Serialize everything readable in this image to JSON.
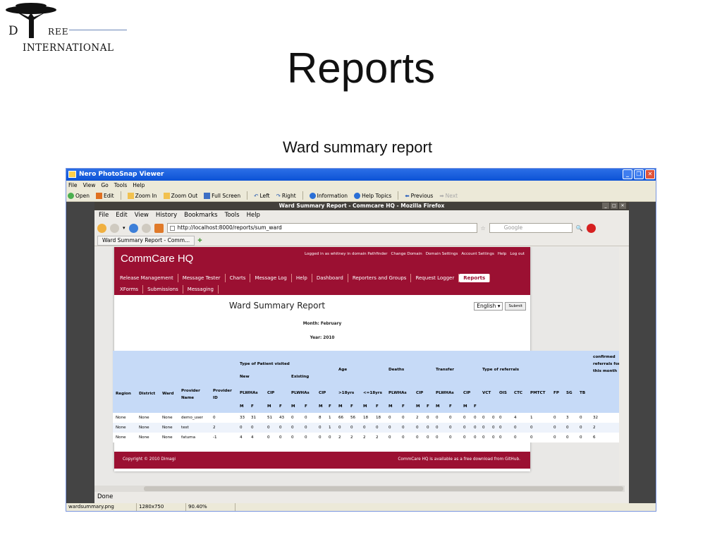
{
  "logo": {
    "d": "D",
    "ree": "REE",
    "intl": "INTERNATIONAL"
  },
  "slide": {
    "title": "Reports",
    "subtitle": "Ward summary  report"
  },
  "viewer": {
    "title": "Nero PhotoSnap Viewer",
    "menu": [
      "File",
      "View",
      "Go",
      "Tools",
      "Help"
    ],
    "toolbar": [
      "Open",
      "Edit",
      "Zoom In",
      "Zoom Out",
      "Full Screen",
      "Left",
      "Right",
      "Information",
      "Help Topics",
      "Previous",
      "Next"
    ],
    "status": {
      "file": "wardsummary.png",
      "dims": "1280x750",
      "zoom": "90.40%"
    }
  },
  "firefox": {
    "title": "Ward Summary Report - Commcare HQ - Mozilla Firefox",
    "menu": [
      "File",
      "Edit",
      "View",
      "History",
      "Bookmarks",
      "Tools",
      "Help"
    ],
    "url": "http://localhost:8000/reports/sum_ward",
    "search_placeholder": "Google",
    "tab": "Ward Summary Report - Comm...",
    "status": "Done"
  },
  "commcare": {
    "brand": "CommCare HQ",
    "user_bar": [
      "Logged in as whitney in domain Pathfinder",
      "Change Domain",
      "Domain Settings",
      "Account Settings",
      "Help",
      "Log out"
    ],
    "tabs_row1": [
      "Release Management",
      "Message Tester",
      "Charts",
      "Message Log",
      "Help",
      "Dashboard",
      "Reporters and Groups",
      "Request Logger",
      "Reports"
    ],
    "tabs_row2": [
      "XForms",
      "Submissions",
      "Messaging"
    ],
    "active_tab": "Reports",
    "report_title": "Ward Summary Report",
    "language": "English",
    "submit": "Submit",
    "month": "Month: February",
    "year": "Year: 2010",
    "footer_left": "Copyright © 2010 Dimagi",
    "footer_right": "CommCare HQ is available as a free download from GitHub."
  },
  "report": {
    "group_headers": [
      "Type of Patient visited",
      "Age",
      "Deaths",
      "Transfer",
      "Type of referrals",
      "confirmed referrals for this month"
    ],
    "sub_headers": [
      "New",
      "Existing"
    ],
    "columns": [
      "Region",
      "District",
      "Ward",
      "Provider Name",
      "Provider ID",
      "PLWHAs",
      "CIP",
      "PLWHAs",
      "CIP",
      ">18yrs",
      "<=18yrs",
      "PLWHAs",
      "CIP",
      "PLWHAs",
      "CIP",
      "VCT",
      "OIS",
      "CTC",
      "PMTCT",
      "FP",
      "SG",
      "TB"
    ],
    "mf": [
      "M",
      "F",
      "M",
      "F",
      "M",
      "F",
      "M",
      "F",
      "M",
      "F",
      "M",
      "F",
      "M",
      "F",
      "M",
      "F",
      "M",
      "F",
      "M",
      "F"
    ],
    "rows": [
      [
        "None",
        "None",
        "None",
        "demo_user",
        "0",
        "33",
        "31",
        "51",
        "43",
        "0",
        "0",
        "8",
        "1",
        "66",
        "56",
        "18",
        "18",
        "0",
        "0",
        "2",
        "0",
        "0",
        "0",
        "0",
        "0",
        "0",
        "0",
        "0",
        "4",
        "1",
        "0",
        "3",
        "0",
        "32"
      ],
      [
        "None",
        "None",
        "None",
        "test",
        "2",
        "0",
        "0",
        "0",
        "0",
        "0",
        "0",
        "0",
        "1",
        "0",
        "0",
        "0",
        "0",
        "0",
        "0",
        "0",
        "0",
        "0",
        "0",
        "0",
        "0",
        "0",
        "0",
        "0",
        "0",
        "0",
        "0",
        "0",
        "0",
        "2"
      ],
      [
        "None",
        "None",
        "None",
        "fatuma",
        "-1",
        "4",
        "4",
        "0",
        "0",
        "0",
        "0",
        "0",
        "0",
        "2",
        "2",
        "2",
        "2",
        "0",
        "0",
        "0",
        "0",
        "0",
        "0",
        "0",
        "0",
        "0",
        "0",
        "0",
        "0",
        "0",
        "0",
        "0",
        "0",
        "6"
      ]
    ]
  }
}
